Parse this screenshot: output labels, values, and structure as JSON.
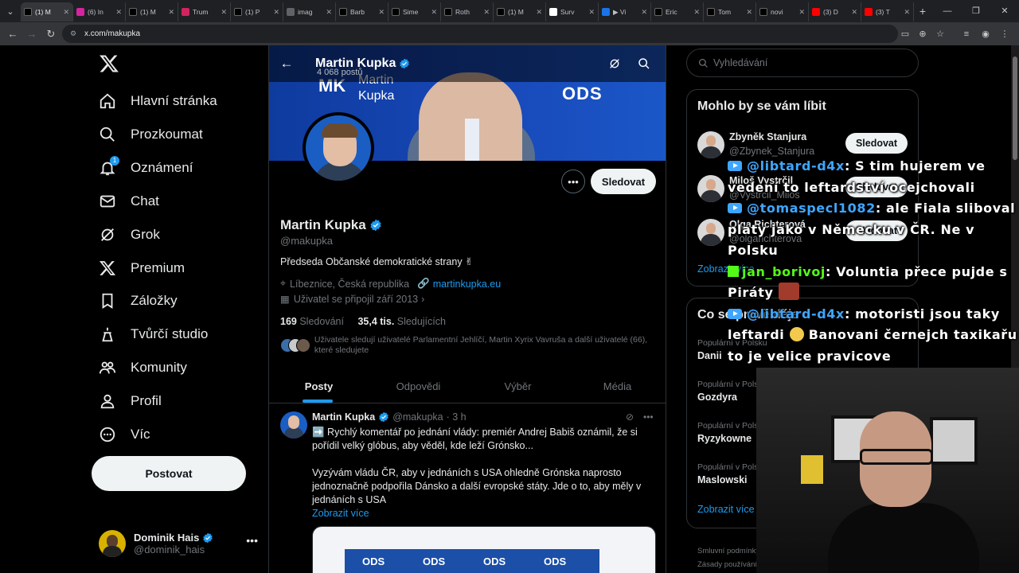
{
  "browser": {
    "tabs": [
      {
        "label": "(1) M",
        "favicon": "x-logo",
        "color": "#000000",
        "active": true
      },
      {
        "label": "(6) In",
        "favicon": "instagram-logo",
        "color": "#d6249f",
        "active": false
      },
      {
        "label": "(1) M",
        "favicon": "x-logo",
        "color": "#000000",
        "active": false
      },
      {
        "label": "Trum",
        "favicon": "truth-social-logo",
        "color": "#d0245f",
        "active": false
      },
      {
        "label": "(1) P",
        "favicon": "x-logo",
        "color": "#000000",
        "active": false
      },
      {
        "label": "imag",
        "favicon": "globe-icon",
        "color": "#5f6368",
        "active": false
      },
      {
        "label": "Barb",
        "favicon": "x-logo",
        "color": "#000000",
        "active": false
      },
      {
        "label": "Sime",
        "favicon": "x-logo",
        "color": "#000000",
        "active": false
      },
      {
        "label": "Roth",
        "favicon": "x-logo",
        "color": "#000000",
        "active": false
      },
      {
        "label": "(1) M",
        "favicon": "x-logo",
        "color": "#000000",
        "active": false
      },
      {
        "label": "Surv",
        "favicon": "chatgpt-logo",
        "color": "#ffffff",
        "active": false
      },
      {
        "label": "▶ Vi",
        "favicon": "video-icon",
        "color": "#1a73e8",
        "active": false
      },
      {
        "label": "Eric",
        "favicon": "x-logo",
        "color": "#000000",
        "active": false
      },
      {
        "label": "Tom",
        "favicon": "x-logo",
        "color": "#000000",
        "active": false
      },
      {
        "label": "novi",
        "favicon": "x-logo",
        "color": "#000000",
        "active": false
      },
      {
        "label": "(3) D",
        "favicon": "youtube-logo",
        "color": "#ff0000",
        "active": false
      },
      {
        "label": "(3) T",
        "favicon": "youtube-logo",
        "color": "#ff0000",
        "active": false
      }
    ],
    "url": "x.com/makupka"
  },
  "nav": {
    "items": [
      {
        "label": "Hlavní stránka",
        "icon": "home-icon"
      },
      {
        "label": "Prozkoumat",
        "icon": "search-icon"
      },
      {
        "label": "Oznámení",
        "icon": "bell-icon",
        "badge": "1"
      },
      {
        "label": "Chat",
        "icon": "mail-icon"
      },
      {
        "label": "Grok",
        "icon": "grok-icon"
      },
      {
        "label": "Premium",
        "icon": "x-premium-icon"
      },
      {
        "label": "Záložky",
        "icon": "bookmark-icon"
      },
      {
        "label": "Tvůrčí studio",
        "icon": "creator-studio-icon"
      },
      {
        "label": "Komunity",
        "icon": "communities-icon"
      },
      {
        "label": "Profil",
        "icon": "profile-icon"
      },
      {
        "label": "Víc",
        "icon": "more-circle-icon"
      }
    ],
    "post_label": "Postovat",
    "me": {
      "name": "Dominik Hais",
      "handle": "@dominik_hais"
    }
  },
  "profile": {
    "header_name": "Martin Kupka",
    "post_count": "4 068 postů",
    "banner_name": "Martin\nKupka",
    "banner_party": "ODS",
    "follow_label": "Sledovat",
    "name": "Martin Kupka",
    "handle": "@makupka",
    "bio": "Předseda Občanské demokratické strany ✌",
    "location": "Líbeznice, Česká republika",
    "website": "martinkupka.eu",
    "joined": "Uživatel se připojil září 2013",
    "following_count": "169",
    "following_label": "Sledování",
    "followers_count": "35,4 tis.",
    "followers_label": "Sledujících",
    "mutual_text": "Uživatele sledují uživatelé Parlamentní Jehlíčí, Martin Xyrix Vavruša a další uživatelé (66), které sledujete"
  },
  "tabs": [
    "Posty",
    "Odpovědi",
    "Výběr",
    "Média"
  ],
  "tweet": {
    "name": "Martin Kupka",
    "handle": "@makupka",
    "time": "· 3 h",
    "line1": "➡️ Rychlý komentář po jednání vlády: premiér Andrej Babiš oznámil, že si pořídil velký glóbus, aby věděl, kde leží Grónsko...",
    "line2": "Vyzývám vládu ČR, aby v jednáních s USA ohledně Grónska naprosto jednoznačně podpořila Dánsko a další evropské státy. Jde o to, aby měly v jednáních s USA",
    "show_more": "Zobrazit více",
    "image_text": [
      "ODS",
      "ODS",
      "ODS",
      "ODS"
    ]
  },
  "right": {
    "search_placeholder": "Vyhledávání",
    "wtf_title": "Mohlo by se vám líbit",
    "suggestions": [
      {
        "name": "Zbyněk Stanjura",
        "handle": "@Zbynek_Stanjura",
        "button": "Sledovat"
      },
      {
        "name": "Miloš Vystrčil",
        "handle": "@Vystrcil_Milos",
        "button": "Sledovat"
      },
      {
        "name": "Olga Richterová",
        "handle": "@olgarichterova",
        "button": "Sledovat"
      }
    ],
    "wtf_more": "Zobrazit více",
    "trends_title": "Co se právě děje",
    "trends": [
      {
        "context": "Populární v Polsku",
        "name": "Danii"
      },
      {
        "context": "Populární v Polsku",
        "name": "Gozdyra"
      },
      {
        "context": "Populární v Polsku",
        "name": "Ryzykowne"
      },
      {
        "context": "Populární v Polsku",
        "name": "Maslowski"
      }
    ],
    "trends_more": "Zobrazit více",
    "footer1": "Smluvní podmínky",
    "footer2": "Zásady používání"
  },
  "chat": [
    {
      "platform": "youtube",
      "user": "@libtard-d4x",
      "text": ": S tim hujerem ve vedení to leftardství ocejchovali"
    },
    {
      "platform": "youtube",
      "user": "@tomaspecl1082",
      "text": ": ale Fiala sliboval platy jako v Německu v ČR. Ne v Polsku"
    },
    {
      "platform": "kick",
      "user": "jan_borivoj",
      "text": ": Voluntia přece pujde s Piráty",
      "emote": true
    },
    {
      "platform": "youtube",
      "user": "@libtard-d4x",
      "text": ": motoristi jsou taky leftardi",
      "text2": " Banovani černejch taxikařu to je velice pravicove"
    }
  ]
}
